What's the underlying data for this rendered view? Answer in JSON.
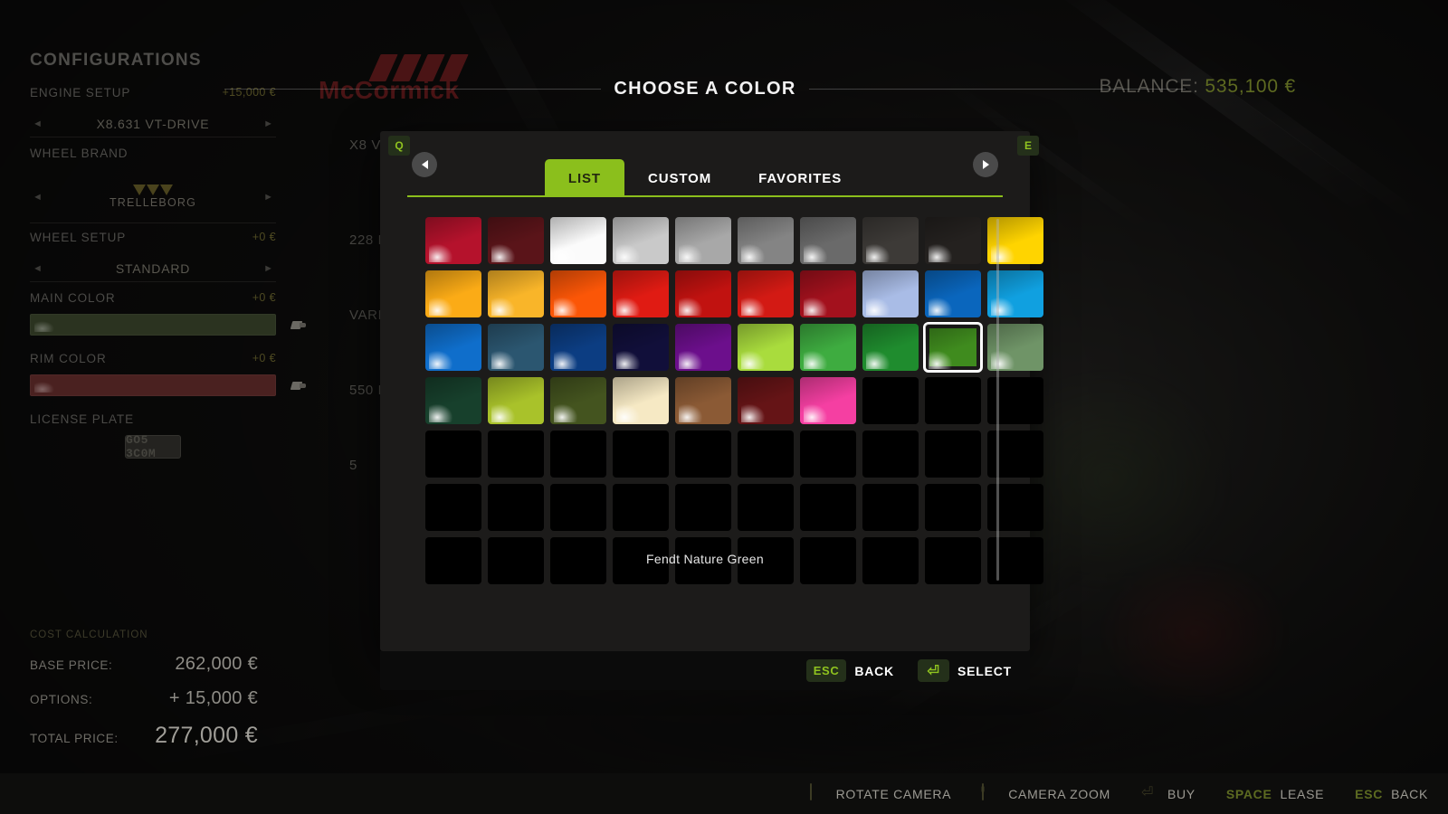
{
  "scene": {
    "brand_logo": "McCormick",
    "balance_label": "BALANCE:",
    "balance_value": "535,100 €",
    "bg_stats": [
      "X8 V",
      "228 K",
      "VARI",
      "550 L",
      "5"
    ]
  },
  "config": {
    "title": "CONFIGURATIONS",
    "rows": [
      {
        "label": "ENGINE SETUP",
        "price": "+15,000 €",
        "value": "X8.631 VT-DRIVE"
      },
      {
        "label": "WHEEL BRAND",
        "price": "",
        "value": "TRELLEBORG"
      },
      {
        "label": "WHEEL SETUP",
        "price": "+0 €",
        "value": "STANDARD"
      },
      {
        "label": "MAIN COLOR",
        "price": "+0 €",
        "value": "",
        "swatch": "#2b3320"
      },
      {
        "label": "RIM COLOR",
        "price": "+0 €",
        "value": "",
        "swatch": "#4a2120"
      },
      {
        "label": "LICENSE PLATE",
        "price": "",
        "value": "GO5 3C0M"
      }
    ],
    "cost": {
      "title": "COST CALCULATION",
      "lines": [
        {
          "key": "BASE PRICE:",
          "value": "262,000 €"
        },
        {
          "key": "OPTIONS:",
          "value": "+ 15,000 €"
        },
        {
          "key": "TOTAL PRICE:",
          "value": "277,000 €"
        }
      ]
    }
  },
  "dialog": {
    "title": "CHOOSE A COLOR",
    "key_prev": "Q",
    "key_next": "E",
    "tabs": [
      {
        "label": "LIST",
        "active": true
      },
      {
        "label": "CUSTOM",
        "active": false
      },
      {
        "label": "FAVORITES",
        "active": false
      }
    ],
    "selected_color_name": "Fendt Nature Green",
    "selected_index": 28,
    "footer": [
      {
        "key": "ESC",
        "label": "BACK"
      },
      {
        "key": "⏎",
        "label": "SELECT"
      }
    ],
    "swatches": [
      "#b5122c",
      "#5a1419",
      "#fbfbfb",
      "#c9c9c9",
      "#a8a8a8",
      "#848484",
      "#6a6a6a",
      "#3d3a37",
      "#24211f",
      "#ffd400",
      "#fbab16",
      "#f9b529",
      "#fb5607",
      "#e01b13",
      "#c11210",
      "#d31a14",
      "#a3111d",
      "#a9bce6",
      "#0a66bd",
      "#10a0e0",
      "#0f6ecb",
      "#2b5670",
      "#0c3d82",
      "#110f3a",
      "#6c0f8c",
      "#a9dc3d",
      "#3eac40",
      "#1f8c2e",
      "#3f8b1e",
      "#6f9467",
      "#17402c",
      "#a9c22a",
      "#44541f",
      "#f6e9c4",
      "#8b5a35",
      "#651416",
      "#f53fa2",
      "#000000",
      "#000000",
      "#000000",
      "#000000",
      "#000000",
      "#000000",
      "#000000",
      "#000000",
      "#000000",
      "#000000",
      "#000000",
      "#000000",
      "#000000",
      "#000000",
      "#000000",
      "#000000",
      "#000000",
      "#000000",
      "#000000",
      "#000000",
      "#000000",
      "#000000",
      "#000000",
      "#000000",
      "#000000",
      "#000000",
      "#000000",
      "#000000",
      "#000000",
      "#000000",
      "#000000",
      "#000000",
      "#000000"
    ]
  },
  "actionbar": [
    {
      "icon": "mouse-icon",
      "text": "ROTATE CAMERA",
      "key": ""
    },
    {
      "icon": "scroll-icon",
      "text": "CAMERA ZOOM",
      "key": ""
    },
    {
      "icon": "enter-icon",
      "text": "BUY",
      "key": ""
    },
    {
      "icon": "",
      "text": "LEASE",
      "key": "SPACE"
    },
    {
      "icon": "",
      "text": "BACK",
      "key": "ESC"
    }
  ]
}
